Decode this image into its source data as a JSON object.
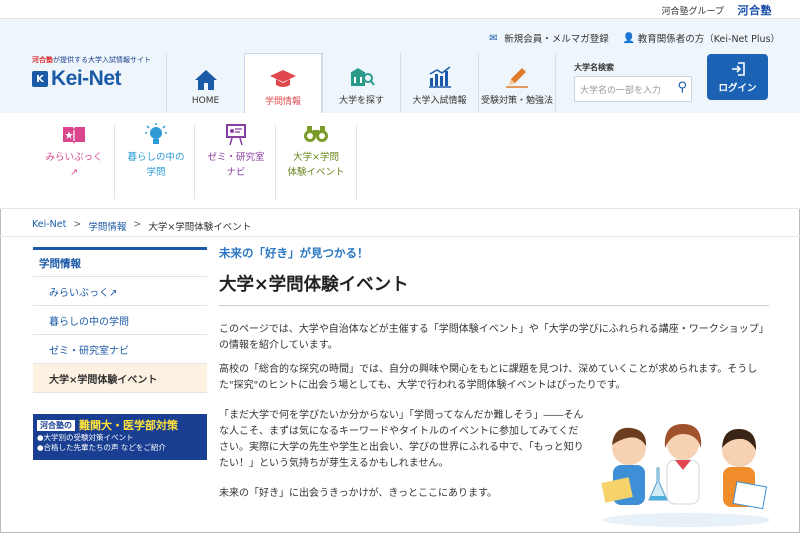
{
  "groupbar": {
    "text": "河合塾グループ",
    "logo": "河合塾"
  },
  "util": {
    "signup": "新規会員・メルマガ登録",
    "educators": "教育関係者の方（Kei-Net Plus）"
  },
  "logo": {
    "tagline_a": "河合塾",
    "tagline_b": "が提供する大学入試情報サイト",
    "mark": "K",
    "name": "Kei-Net"
  },
  "nav": [
    {
      "label": "HOME",
      "icon": "home-icon"
    },
    {
      "label": "学問情報",
      "icon": "graduation-cap-icon"
    },
    {
      "label": "大学を探す",
      "icon": "university-search-icon"
    },
    {
      "label": "大学入試情報",
      "icon": "bar-chart-icon"
    },
    {
      "label": "受験対策・勉強法",
      "icon": "pencil-icon"
    }
  ],
  "search": {
    "label": "大学名検索",
    "placeholder": "大学名の一部を入力"
  },
  "login": {
    "label": "ログイン"
  },
  "submenu": [
    {
      "l1": "みらいぶっく",
      "l2": "↗",
      "icon": "book-icon"
    },
    {
      "l1": "暮らしの中の",
      "l2": "学問",
      "icon": "lightbulb-icon"
    },
    {
      "l1": "ゼミ・研究室",
      "l2": "ナビ",
      "icon": "presentation-icon"
    },
    {
      "l1": "大学×学問",
      "l2": "体験イベント",
      "icon": "binoculars-icon"
    }
  ],
  "breadcrumb": [
    "Kei-Net",
    "学問情報",
    "大学×学問体験イベント"
  ],
  "sidebar": {
    "header": "学問情報",
    "items": [
      "みらいぶっく↗",
      "暮らしの中の学問",
      "ゼミ・研究室ナビ",
      "大学×学問体験イベント"
    ]
  },
  "banner": {
    "kawai": "河合塾の",
    "title": "難関大・医学部対策",
    "line1": "●大学別の受験対策イベント",
    "line2": "●合格した先輩たちの声 などをご紹介"
  },
  "main": {
    "lead": "未来の「好き」が見つかる！",
    "title": "大学×学問体験イベント",
    "p1": "このページでは、大学や自治体などが主催する「学問体験イベント」や「大学の学びにふれられる講座・ワークショップ」の情報を紹介しています。",
    "p2": "高校の「総合的な探究の時間」では、自分の興味や関心をもとに課題を見つけ、深めていくことが求められます。そうした\"探究\"のヒントに出会う場としても、大学で行われる学問体験イベントはぴったりです。",
    "p3": "「まだ大学で何を学びたいか分からない」「学問ってなんだか難しそう」――そんな人こそ、まずは気になるキーワードやタイトルのイベントに参加してみてください。実際に大学の先生や学生と出会い、学びの世界にふれる中で、「もっと知りたい！」という気持ちが芽生えるかもしれません。",
    "p4": "未来の「好き」に出会うきっかけが、きっとここにあります。"
  }
}
